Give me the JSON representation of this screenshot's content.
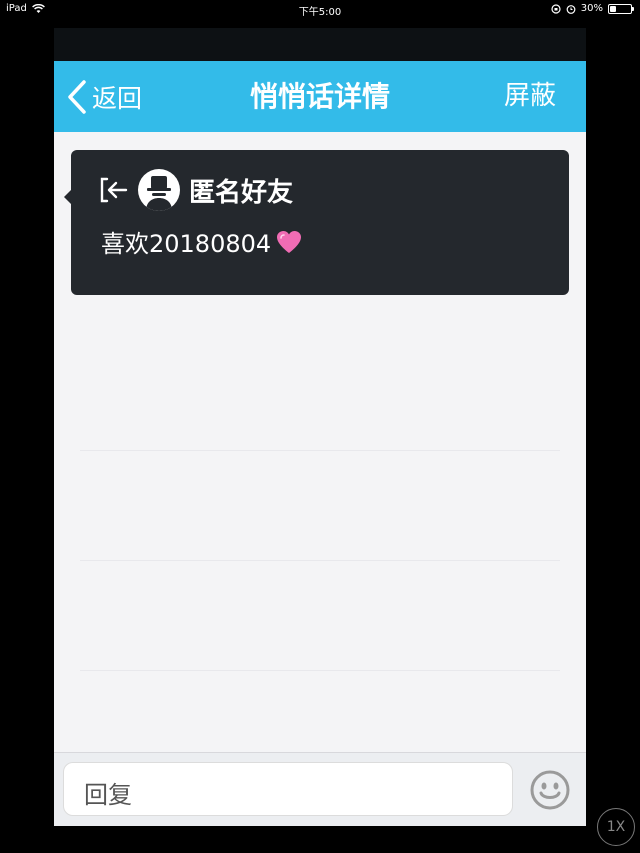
{
  "status_bar": {
    "device": "iPad",
    "time": "下午5:00",
    "battery": "30%",
    "battery_level": 0.3
  },
  "nav": {
    "back_label": "返回",
    "title": "悄悄话详情",
    "right_action": "屏蔽"
  },
  "message": {
    "sender": "匿名好友",
    "text": "喜欢20180804",
    "emoji": "💗"
  },
  "reply": {
    "placeholder": "回复"
  },
  "icons": {
    "back": "chevron-left-icon",
    "exit": "exit-arrow-icon",
    "avatar": "anonymous-avatar-icon",
    "emoji": "smiley-face-icon",
    "wifi": "wifi-icon",
    "lock": "rotation-lock-icon",
    "alarm": "alarm-icon",
    "battery": "battery-icon"
  },
  "overlay": {
    "speed": "1X"
  },
  "colors": {
    "nav_bg": "#33bbe9",
    "bubble_bg": "#24282d",
    "page_bg": "#f4f4f6"
  }
}
